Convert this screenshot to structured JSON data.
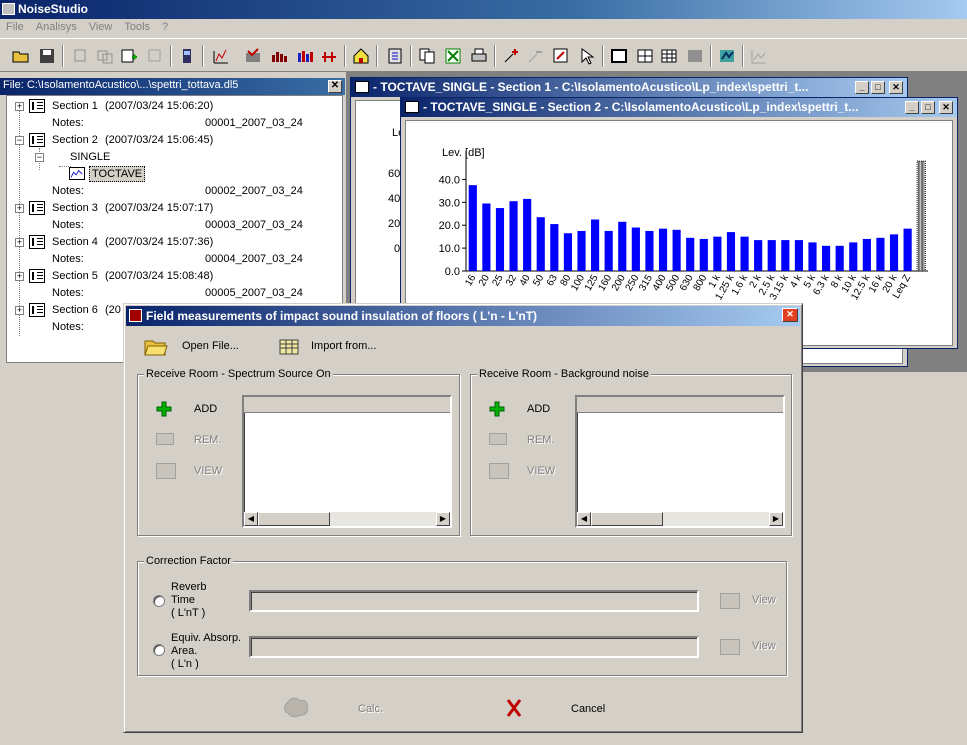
{
  "app": {
    "title": "NoiseStudio"
  },
  "menu": {
    "items": [
      "File",
      "Analisys",
      "View",
      "Tools",
      "?"
    ]
  },
  "tree": {
    "title": "File: C:\\IsolamentoAcustico\\...\\spettri_tottava.dl5",
    "rows": [
      {
        "label": "Section 1",
        "date": "(2007/03/24 15:06:20)"
      },
      {
        "label": "Notes:",
        "value": "00001_2007_03_24"
      },
      {
        "label": "Section 2",
        "date": "(2007/03/24 15:06:45)"
      },
      {
        "label": "SINGLE"
      },
      {
        "label": "TOCTAVE"
      },
      {
        "label": "Notes:",
        "value": "00002_2007_03_24"
      },
      {
        "label": "Section 3",
        "date": "(2007/03/24 15:07:17)"
      },
      {
        "label": "Notes:",
        "value": "00003_2007_03_24"
      },
      {
        "label": "Section 4",
        "date": "(2007/03/24 15:07:36)"
      },
      {
        "label": "Notes:",
        "value": "00004_2007_03_24"
      },
      {
        "label": "Section 5",
        "date": "(2007/03/24 15:08:48)"
      },
      {
        "label": "Notes:",
        "value": "00005_2007_03_24"
      },
      {
        "label": "Section 6",
        "date": "(20"
      },
      {
        "label": "Notes:"
      }
    ]
  },
  "win1": {
    "title": "- TOCTAVE_SINGLE - Section 1 -  C:\\IsolamentoAcustico\\Lp_index\\spettri_t...",
    "ylabel_partial": "Le",
    "ticks": [
      "60",
      "40",
      "20",
      "0"
    ]
  },
  "win2": {
    "title": "- TOCTAVE_SINGLE - Section 2 -  C:\\IsolamentoAcustico\\Lp_index\\spettri_t..."
  },
  "chart_data": {
    "type": "bar",
    "ylabel": "Lev. [dB]",
    "ylim": [
      0,
      45
    ],
    "yticks": [
      "0.0",
      "10.0",
      "20.0",
      "30.0",
      "40.0"
    ],
    "categories": [
      "16",
      "20",
      "25",
      "32",
      "40",
      "50",
      "63",
      "80",
      "100",
      "125",
      "160",
      "200",
      "250",
      "315",
      "400",
      "500",
      "630",
      "800",
      "1 k",
      "1.25 k",
      "1.6 k",
      "2 k",
      "2.5 k",
      "3.15 k",
      "4 k",
      "5 k",
      "6.3 k",
      "8 k",
      "10 k",
      "12.5 k",
      "16 k",
      "20 k",
      "Leq Z"
    ],
    "values": [
      37.5,
      29.5,
      27.5,
      30.5,
      31.5,
      23.5,
      20.5,
      16.5,
      17.5,
      22.5,
      17.5,
      21.5,
      19.0,
      17.5,
      18.5,
      18.0,
      14.5,
      14.0,
      15.0,
      17.0,
      15.0,
      13.5,
      13.5,
      13.5,
      13.5,
      12.5,
      11.0,
      11.0,
      12.5,
      14.0,
      14.5,
      16.0,
      18.5,
      49.0
    ],
    "bar_color": "#0000ff",
    "grid": false
  },
  "dialog": {
    "title": "Field measurements of impact sound insulation of floors ( L'n - L'nT)",
    "open_file": "Open File...",
    "import_from": "Import from...",
    "left_group": "Receive Room - Spectrum Source On",
    "right_group": "Receive Room - Background noise",
    "add": "ADD",
    "rem": "REM.",
    "view": "VIEW",
    "correction_group": "Correction Factor",
    "reverb_line1": "Reverb",
    "reverb_line2": "Time",
    "reverb_line3": "( L'nT )",
    "equiv_line1": "Equiv. Absorp.",
    "equiv_line2": "Area.",
    "equiv_line3": "( L'n )",
    "view_btn": "View",
    "calc": "Calc.",
    "cancel": "Cancel"
  },
  "colors": {
    "accent": "#0a246a",
    "window_bg": "#d4d0c8",
    "add_green": "#00a000",
    "cancel_red": "#c00000"
  }
}
